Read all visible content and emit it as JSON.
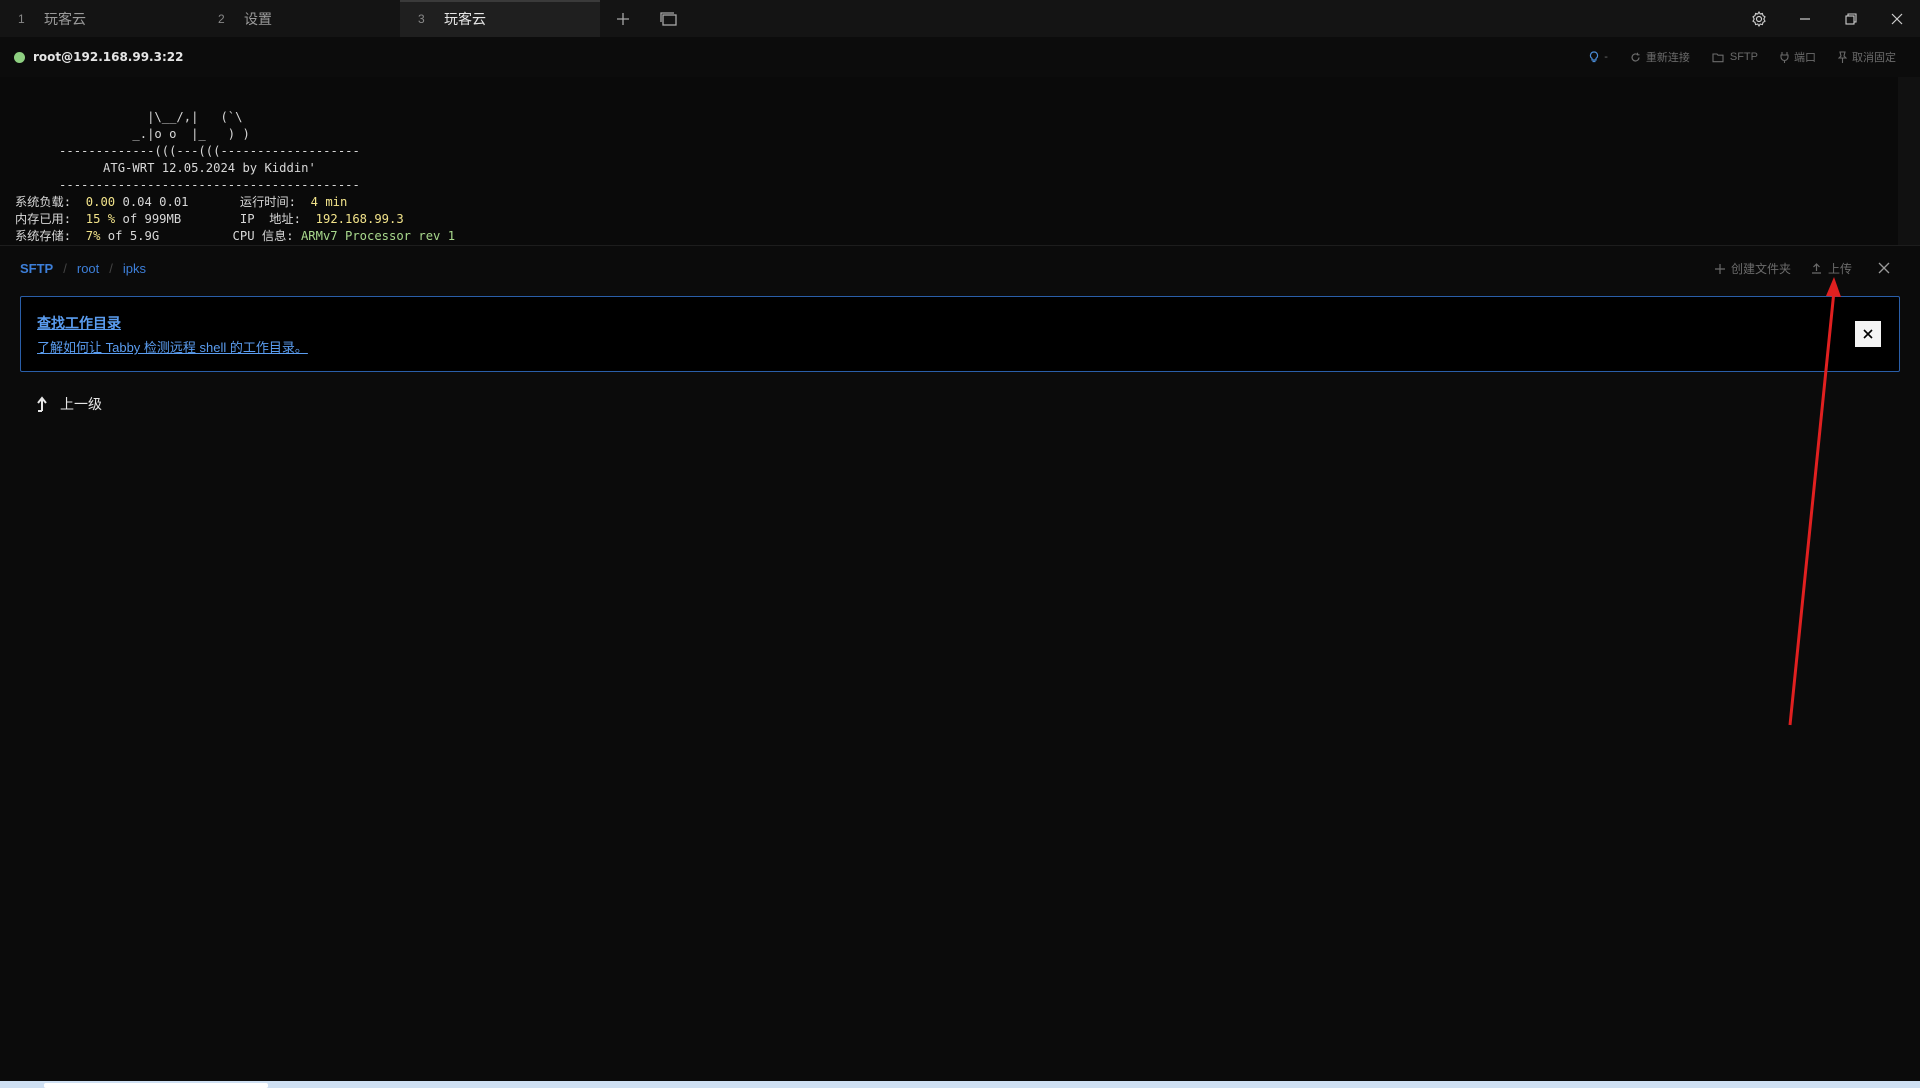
{
  "tabs": [
    {
      "num": "1",
      "label": "玩客云"
    },
    {
      "num": "2",
      "label": "设置"
    },
    {
      "num": "3",
      "label": "玩客云"
    }
  ],
  "icons": {
    "new_tab": "plus-icon",
    "tab_overview": "window-stack-icon",
    "settings": "gear-icon",
    "minimize": "minimize-icon",
    "restore": "restore-icon",
    "close": "close-icon"
  },
  "terminal_header": {
    "host": "root@192.168.99.3:22",
    "status_color": "#8ed081",
    "actions": {
      "bulb_dropdown": "-",
      "reconnect": "重新连接",
      "sftp": "SFTP",
      "ports": "端口",
      "unpin": "取消固定"
    }
  },
  "terminal": {
    "banner": [
      "                  |\\__/,|   (`\\",
      "                _.|o o  |_   ) )",
      "      -------------(((---(((-------------------",
      "            ATG-WRT 12.05.2024 by Kiddin'",
      "      -----------------------------------------"
    ],
    "stats": [
      {
        "label": "系统负载:",
        "hl": "0.00",
        "rest": " 0.04 0.01",
        "label2": "运行时间:",
        "value2": "4 min"
      },
      {
        "label": "内存已用:",
        "hl": "15 %",
        "rest": " of 999MB",
        "label2": "IP  地址:",
        "value2": "192.168.99.3"
      },
      {
        "label": "系统存储:",
        "hl": "7%",
        "rest": " of 5.9G",
        "label2": "CPU 信息:",
        "value2": "ARMv7 Processor rev 1"
      }
    ]
  },
  "sftp": {
    "label": "SFTP",
    "path": [
      "root",
      "ipks"
    ],
    "actions": {
      "create_folder": "创建文件夹",
      "upload": "上传"
    },
    "notice": {
      "title": "查找工作目录",
      "body": "了解如何让 Tabby 检测远程 shell 的工作目录。"
    },
    "parent_dir": "上一级"
  },
  "annotation_color": "#e02020"
}
